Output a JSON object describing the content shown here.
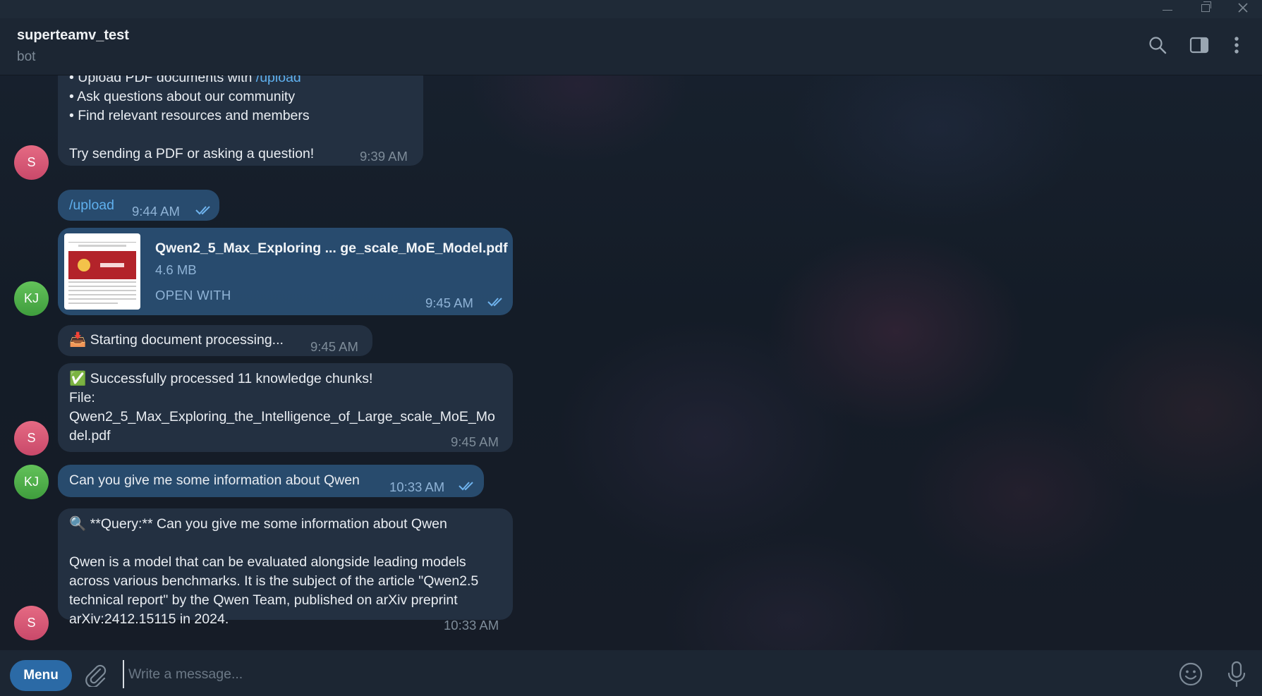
{
  "header": {
    "title": "superteamv_test",
    "status": "bot"
  },
  "messages": {
    "welcome": {
      "line_partial": "• Upload PDF documents with ",
      "upload_cmd": "/upload",
      "line2": "• Ask questions about our community",
      "line3": "• Find relevant resources and members",
      "line4": "Try sending a PDF or asking a question!",
      "time": "9:39 AM",
      "avatar": "S"
    },
    "upload_cmd": {
      "text": "/upload",
      "time": "9:44 AM"
    },
    "document": {
      "name": "Qwen2_5_Max_Exploring ...  ge_scale_MoE_Model.pdf",
      "size": "4.6 MB",
      "action": "OPEN WITH",
      "time": "9:45 AM",
      "avatar": "KJ",
      "thumb_banner": "Qwen2.5-Max"
    },
    "processing": {
      "emoji": "📥",
      "text": "Starting document processing...",
      "time": "9:45 AM"
    },
    "success": {
      "emoji": "✅",
      "line1": "Successfully processed 11 knowledge chunks!",
      "line2": "File:",
      "line3": "Qwen2_5_Max_Exploring_the_Intelligence_of_Large_scale_MoE_Mo",
      "line4": "del.pdf",
      "time": "9:45 AM",
      "avatar": "S"
    },
    "question": {
      "text": "Can you give me some information about Qwen",
      "time": "10:33 AM",
      "avatar": "KJ"
    },
    "answer": {
      "emoji": "🔍",
      "query_line": "**Query:** Can you give me some information about Qwen",
      "line1": "Qwen is a model that can be evaluated alongside leading models",
      "line2": "across various benchmarks. It is the subject of the article \"Qwen2.5",
      "line3": "technical report\" by the Qwen Team, published on arXiv preprint",
      "line4": "arXiv:2412.15115 in 2024.",
      "time": "10:33 AM",
      "avatar": "S"
    }
  },
  "composer": {
    "menu_label": "Menu",
    "placeholder": "Write a message..."
  },
  "colors": {
    "accent": "#2b6aa6",
    "link": "#5fb0ee",
    "incoming_bubble": "#253243",
    "outgoing_bubble": "#2b5278"
  },
  "icons": [
    "minimize-icon",
    "maximize-icon",
    "close-icon",
    "search-icon",
    "side-panel-icon",
    "more-vertical-icon",
    "double-check-icon",
    "paperclip-icon",
    "emoji-icon",
    "microphone-icon"
  ]
}
